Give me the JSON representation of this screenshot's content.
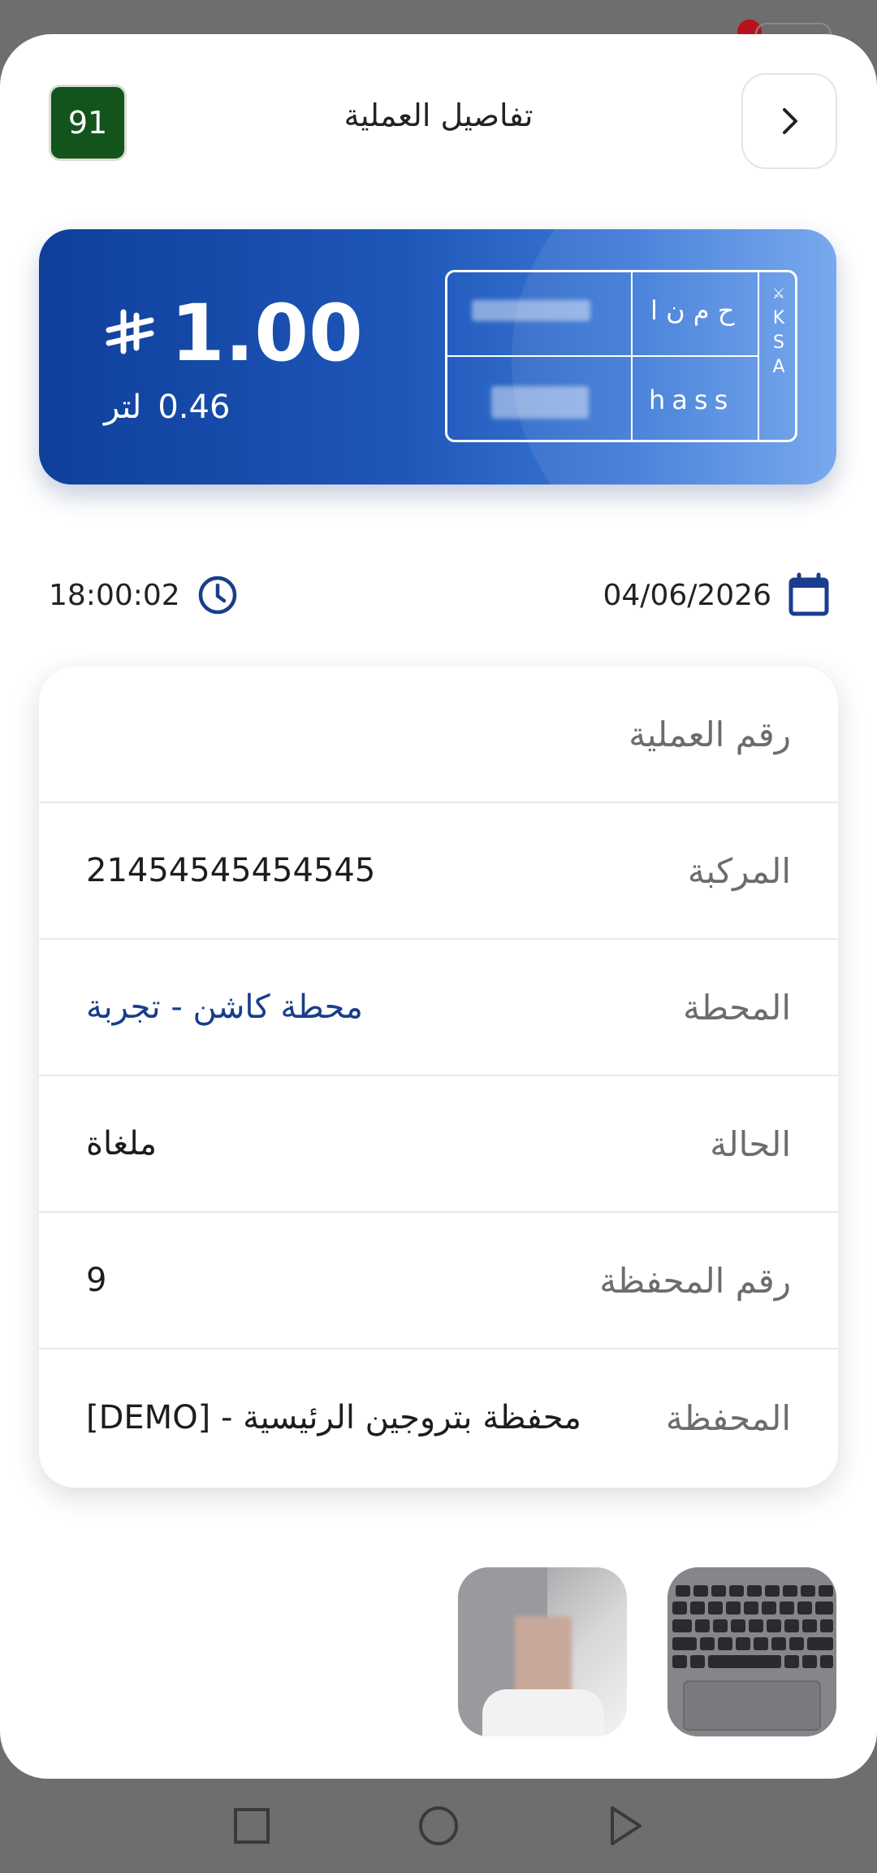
{
  "header": {
    "badge": "91",
    "title": "تفاصيل العملية",
    "back_icon": "chevron-right-icon"
  },
  "card": {
    "amount": "1.00",
    "currency_icon": "saudi-riyal-icon",
    "liters_value": "0.46",
    "liters_unit": "لتر",
    "plate": {
      "letters_ar": "ح م ن ا",
      "letters_en": "hass",
      "country": [
        "K",
        "S",
        "A"
      ]
    }
  },
  "meta": {
    "time": "18:00:02",
    "date": "04/06/2026",
    "time_icon": "clock-icon",
    "date_icon": "calendar-icon"
  },
  "details": [
    {
      "label": "رقم العملية",
      "value": ""
    },
    {
      "label": "المركبة",
      "value": "21454545454545"
    },
    {
      "label": "المحطة",
      "value": "محطة كاشن - تجربة"
    },
    {
      "label": "الحالة",
      "value": "ملغاة"
    },
    {
      "label": "رقم المحفظة",
      "value": "9"
    },
    {
      "label": "المحفظة",
      "value": "[DEMO] - محفظة بتروجين الرئيسية"
    }
  ],
  "colors": {
    "accent": "#1a3d8c",
    "badge_green": "#13541d",
    "card_dark": "#0f3f9b",
    "card_light": "#6ea2ec"
  }
}
